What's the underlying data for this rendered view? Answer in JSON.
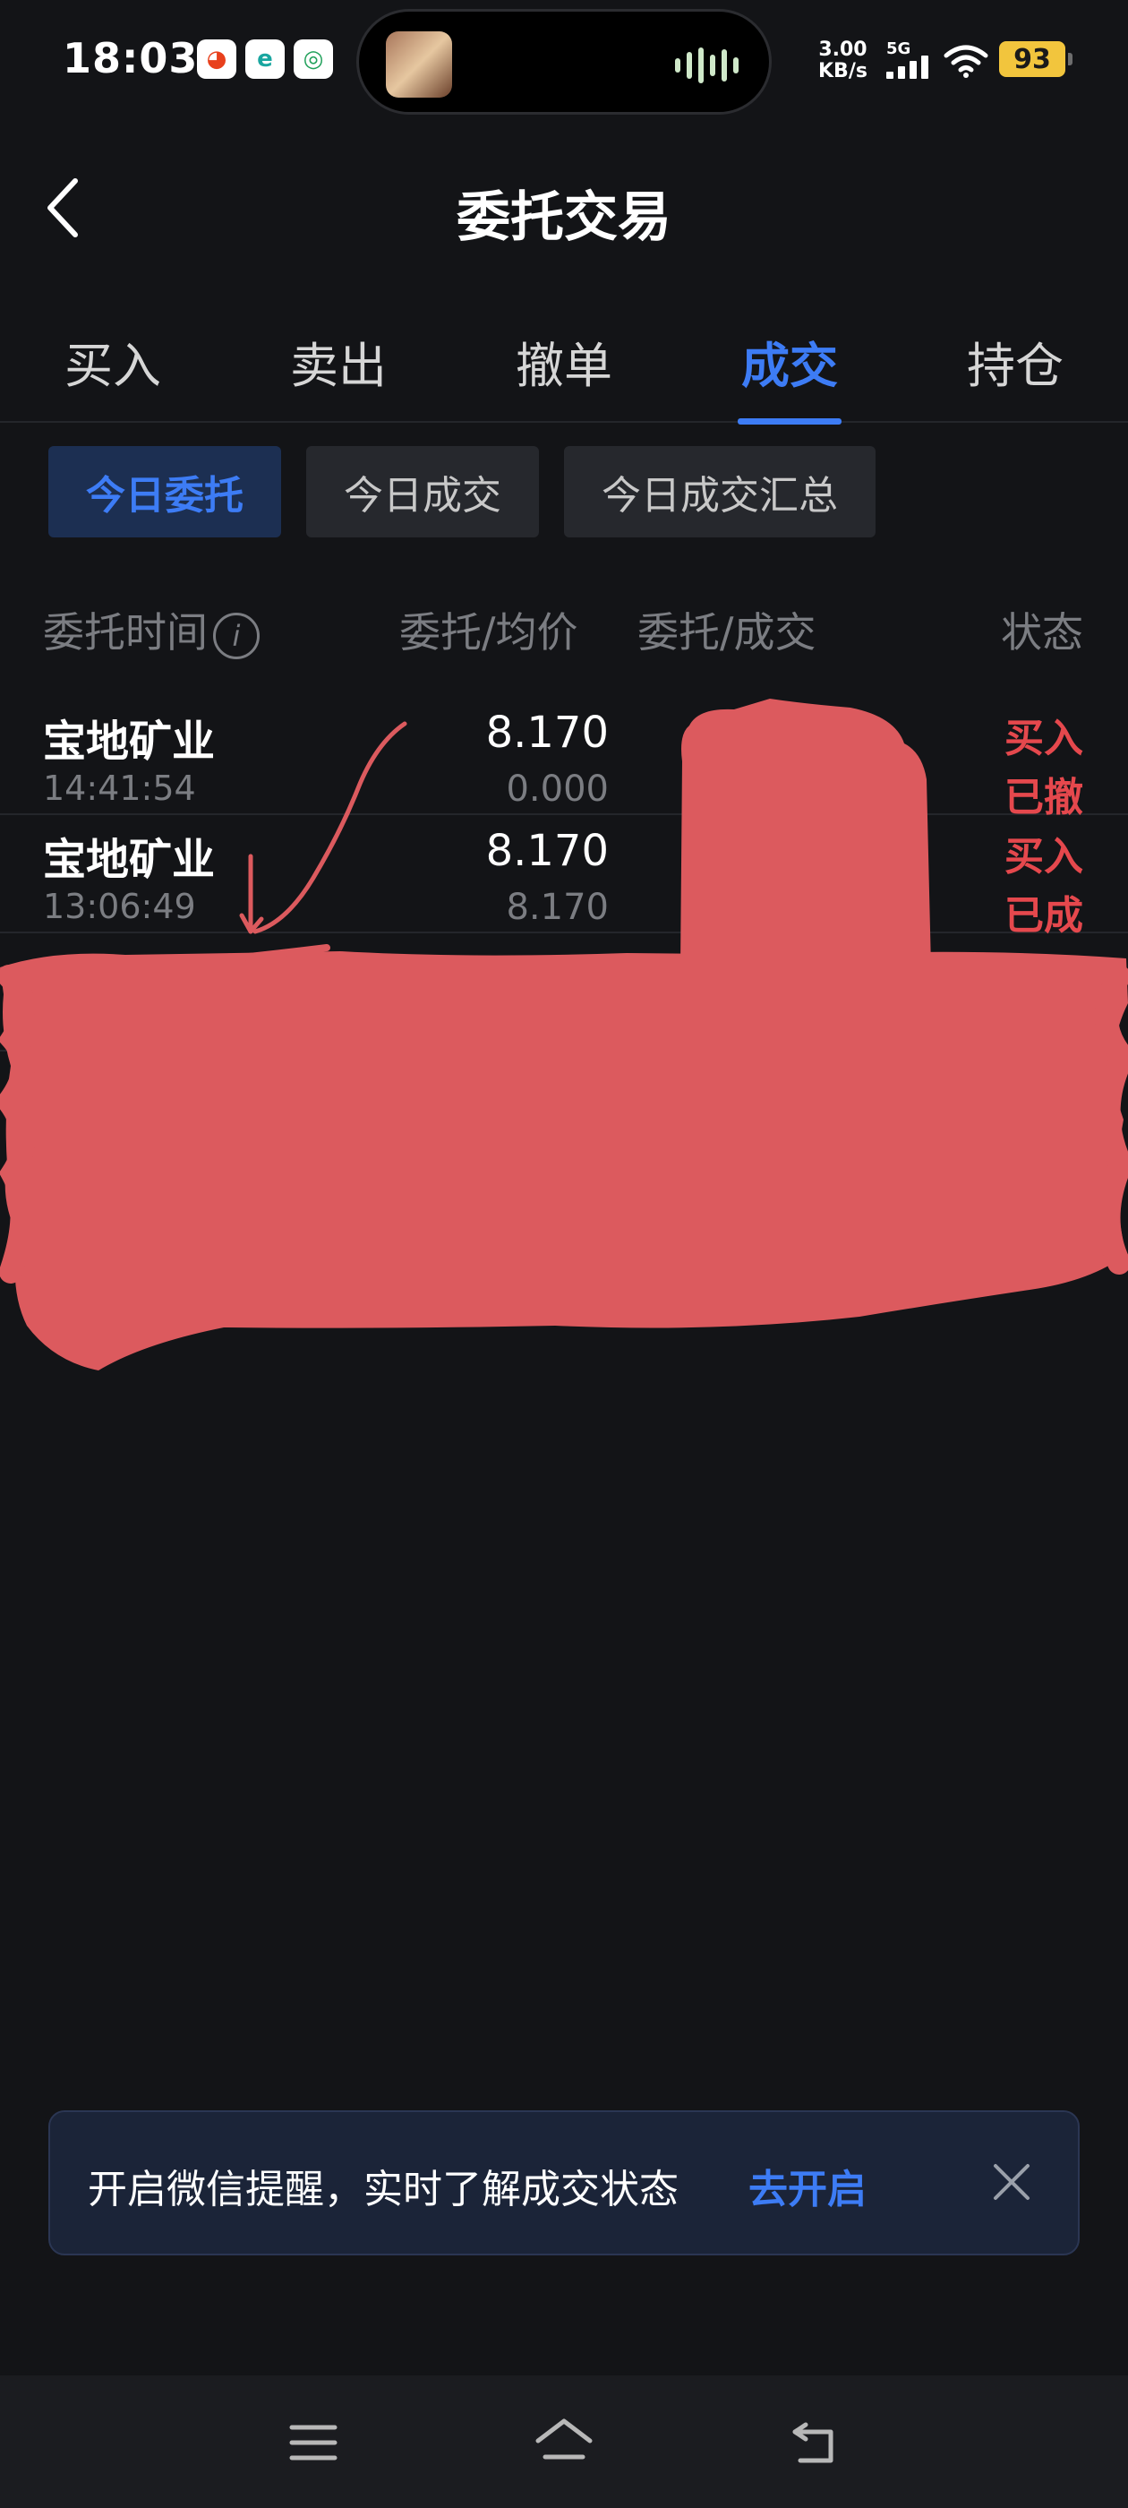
{
  "status_bar": {
    "time": "18:03",
    "net_speed_value": "3.00",
    "net_speed_unit": "KB/s",
    "network_type": "5G",
    "battery_level": "93",
    "app_icons": [
      "taobao-icon",
      "browser-icon",
      "mobile-service-icon"
    ]
  },
  "header": {
    "title": "委托交易",
    "back_icon": "chevron-left-icon"
  },
  "tabs": [
    {
      "label": "买入",
      "active": false
    },
    {
      "label": "卖出",
      "active": false
    },
    {
      "label": "撤单",
      "active": false
    },
    {
      "label": "成交",
      "active": true
    },
    {
      "label": "持仓",
      "active": false
    }
  ],
  "chips": [
    {
      "label": "今日委托",
      "active": true
    },
    {
      "label": "今日成交",
      "active": false
    },
    {
      "label": "今日成交汇总",
      "active": false
    }
  ],
  "columns": {
    "time": "委托时间",
    "price": "委托/均价",
    "qty": "委托/成交",
    "status": "状态"
  },
  "orders": [
    {
      "name": "宝地矿业",
      "time": "14:41:54",
      "price": "8.170",
      "avg_price": "0.000",
      "side": "买入",
      "status": "已撤"
    },
    {
      "name": "宝地矿业",
      "time": "13:06:49",
      "price": "8.170",
      "avg_price": "8.170",
      "side": "买入",
      "status": "已成"
    }
  ],
  "notice": {
    "text": "开启微信提醒，实时了解成交状态",
    "link": "去开启"
  },
  "colors": {
    "accent": "#3d7cf5",
    "buy": "#e5484d",
    "sell": "#3d7cf5",
    "background": "#131417",
    "redaction": "#dc5a5e"
  }
}
